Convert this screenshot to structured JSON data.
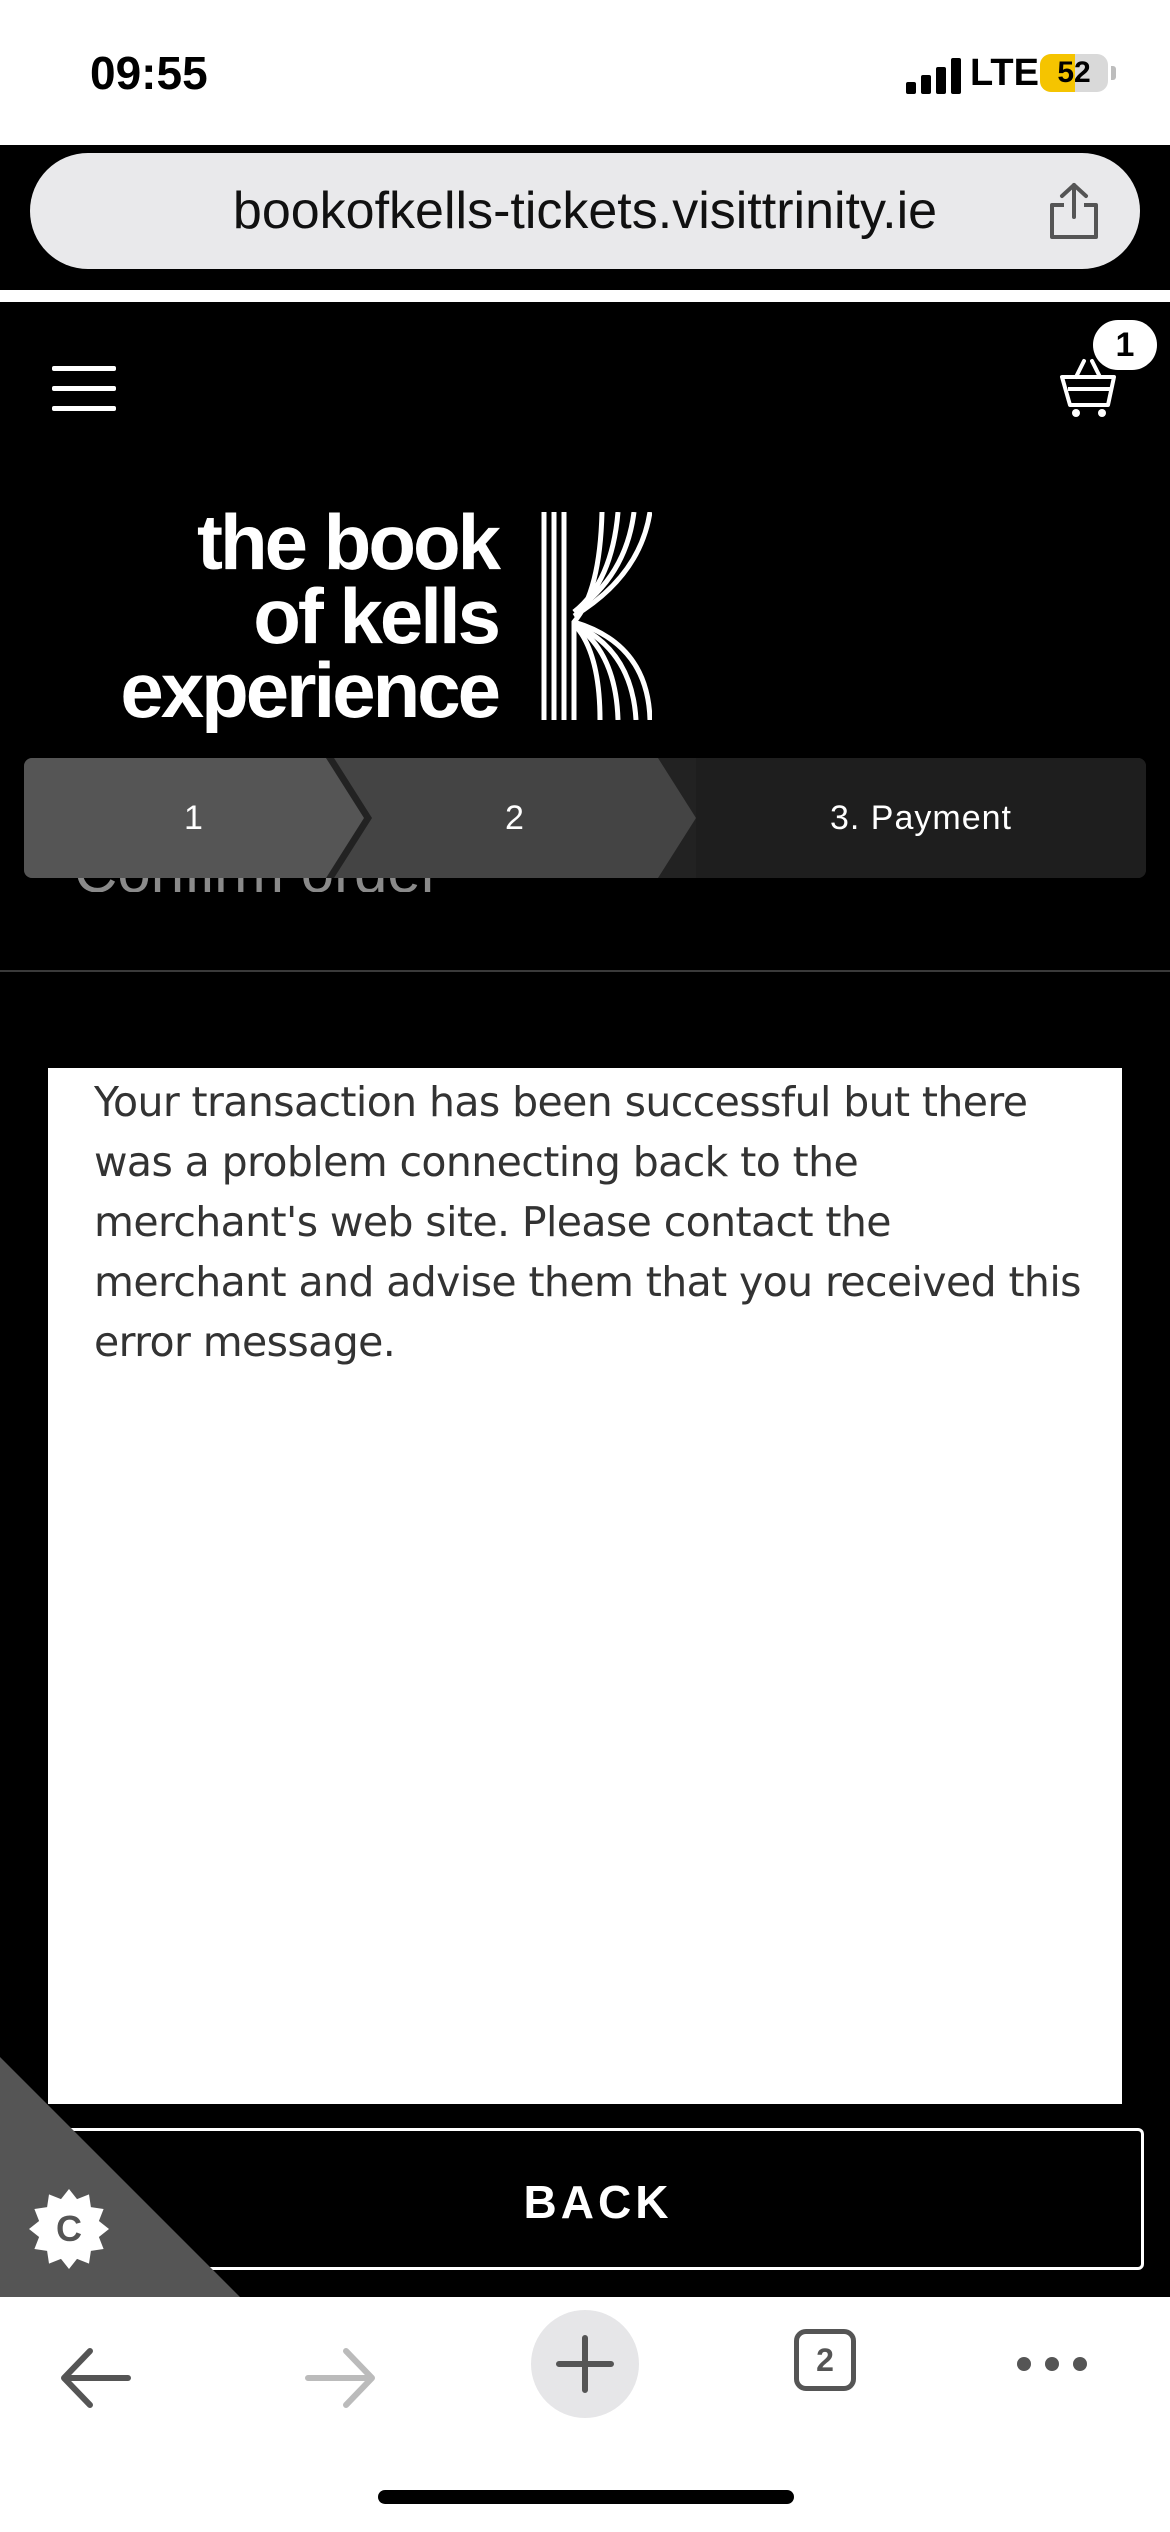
{
  "status_bar": {
    "time": "09:55",
    "network": "LTE",
    "battery": "52",
    "battery_level": 0.52,
    "battery_color": "#f5c400"
  },
  "browser": {
    "url": "bookofkells-tickets.visittrinity.ie",
    "share_icon": "share-icon",
    "tab_count": "2"
  },
  "site_header": {
    "menu_icon": "hamburger-menu-icon",
    "cart_icon": "shopping-basket-icon",
    "cart_count": "1",
    "logo_lines": [
      "the book",
      "of kells",
      "experience"
    ]
  },
  "steps": [
    {
      "label": "1"
    },
    {
      "label": "2"
    },
    {
      "label": "3. Payment"
    }
  ],
  "page_title_partial": "Confirm order",
  "message": "Your transaction has been successful but there was a problem connecting back to the merchant's web site. Please contact the merchant and advise them that you received this error message.",
  "back_button": "BACK",
  "cookie_button_icon": "cookie-settings-icon",
  "colors": {
    "site_background": "#000000",
    "step_active": "#1e1e1e",
    "step_inactive": "#555555"
  }
}
